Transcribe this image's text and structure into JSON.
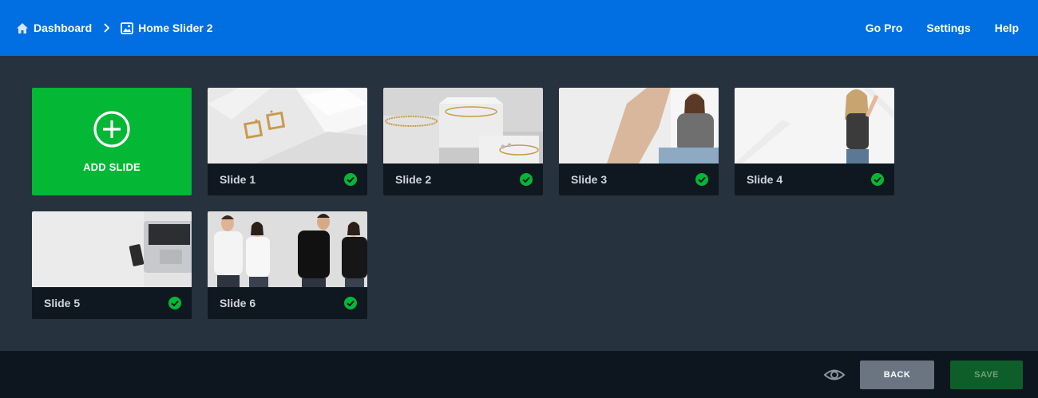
{
  "breadcrumb": {
    "dashboard": "Dashboard",
    "current": "Home Slider 2"
  },
  "topnav": {
    "go_pro": "Go Pro",
    "settings": "Settings",
    "help": "Help"
  },
  "add_slide": {
    "label": "ADD SLIDE"
  },
  "slides": [
    {
      "label": "Slide 1",
      "status": "active"
    },
    {
      "label": "Slide 2",
      "status": "active"
    },
    {
      "label": "Slide 3",
      "status": "active"
    },
    {
      "label": "Slide 4",
      "status": "active"
    },
    {
      "label": "Slide 5",
      "status": "active"
    },
    {
      "label": "Slide 6",
      "status": "active"
    }
  ],
  "footer": {
    "back": "BACK",
    "save": "SAVE"
  },
  "colors": {
    "header": "#016fe2",
    "add": "#04b735",
    "check": "#04b735",
    "back": "#6a7581",
    "save": "#0d5e29"
  }
}
